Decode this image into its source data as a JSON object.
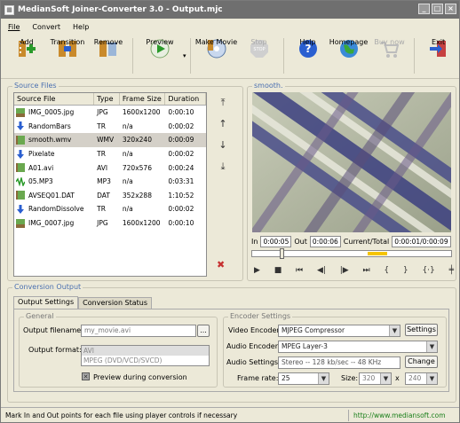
{
  "window": {
    "title": "MedianSoft Joiner-Converter 3.0 - Output.mjc"
  },
  "menu": [
    "File",
    "Convert",
    "Help"
  ],
  "toolbar": [
    {
      "label": "Add",
      "icon": "add-icon",
      "enabled": true
    },
    {
      "label": "Transition",
      "icon": "transition-icon",
      "enabled": true
    },
    {
      "label": "Remove",
      "icon": "remove-icon",
      "enabled": true
    },
    {
      "label": "Preview",
      "icon": "preview-icon",
      "enabled": true
    },
    {
      "label": "Make Movie",
      "icon": "make-movie-icon",
      "enabled": true
    },
    {
      "label": "Stop",
      "icon": "stop-icon",
      "enabled": false
    },
    {
      "label": "Help",
      "icon": "help-icon",
      "enabled": true
    },
    {
      "label": "Homepage",
      "icon": "homepage-icon",
      "enabled": true
    },
    {
      "label": "Buy now",
      "icon": "cart-icon",
      "enabled": false
    },
    {
      "label": "Exit",
      "icon": "exit-icon",
      "enabled": true
    }
  ],
  "source_files": {
    "label": "Source Files",
    "columns": [
      "Source File",
      "Type",
      "Frame Size",
      "Duration"
    ],
    "rows": [
      {
        "name": "IMG_0005.jpg",
        "type": "JPG",
        "size": "1600x1200",
        "duration": "0:00:10",
        "icon": "image-icon"
      },
      {
        "name": "RandomBars",
        "type": "TR",
        "size": "n/a",
        "duration": "0:00:02",
        "icon": "transition-arrow-icon"
      },
      {
        "name": "smooth.wmv",
        "type": "WMV",
        "size": "320x240",
        "duration": "0:00:09",
        "icon": "video-icon",
        "selected": true
      },
      {
        "name": "Pixelate",
        "type": "TR",
        "size": "n/a",
        "duration": "0:00:02",
        "icon": "transition-arrow-icon"
      },
      {
        "name": "A01.avi",
        "type": "AVI",
        "size": "720x576",
        "duration": "0:00:24",
        "icon": "video-icon"
      },
      {
        "name": "05.MP3",
        "type": "MP3",
        "size": "n/a",
        "duration": "0:03:31",
        "icon": "audio-icon"
      },
      {
        "name": "AVSEQ01.DAT",
        "type": "DAT",
        "size": "352x288",
        "duration": "1:10:52",
        "icon": "video-icon"
      },
      {
        "name": "RandomDissolve",
        "type": "TR",
        "size": "n/a",
        "duration": "0:00:02",
        "icon": "transition-arrow-icon"
      },
      {
        "name": "IMG_0007.jpg",
        "type": "JPG",
        "size": "1600x1200",
        "duration": "0:00:10",
        "icon": "image-icon"
      }
    ]
  },
  "preview": {
    "label": "smooth.",
    "in_label": "In",
    "in_value": "0:00:05",
    "out_label": "Out",
    "out_value": "0:00:06",
    "current_label": "Current/Total",
    "current_value": "0:00:01/0:00:09"
  },
  "conversion": {
    "label": "Conversion Output",
    "tabs": [
      "Output Settings",
      "Conversion Status"
    ],
    "general_label": "General",
    "output_filename_label": "Output filename:",
    "output_filename_value": "my_movie.avi",
    "output_format_label": "Output format:",
    "formats": [
      "AVI",
      "MPEG (DVD/VCD/SVCD)"
    ],
    "preview_checkbox": "Preview during conversion",
    "encoder_label": "Encoder Settings",
    "video_encoder_label": "Video Encoder:",
    "video_encoder_value": "MJPEG Compressor",
    "settings_button": "Settings",
    "audio_encoder_label": "Audio Encoder:",
    "audio_encoder_value": "MPEG Layer-3",
    "audio_settings_label": "Audio Settings:",
    "audio_settings_value": "Stereo -- 128 kb/sec -- 48 KHz",
    "change_button": "Change",
    "frame_rate_label": "Frame rate:",
    "frame_rate_value": "25",
    "size_label": "Size:",
    "width_value": "320",
    "x_label": "x",
    "height_value": "240"
  },
  "status": {
    "message": "Mark In and Out points for each file using player controls if necessary",
    "url": "http://www.mediansoft.com"
  }
}
